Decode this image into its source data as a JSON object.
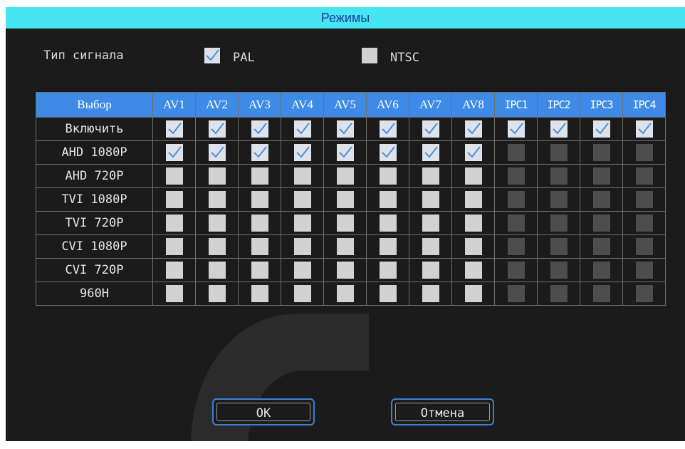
{
  "dialog": {
    "title": "Режимы",
    "signal_type": {
      "label": "Тип сигнала",
      "options": [
        {
          "label": "PAL",
          "checked": true
        },
        {
          "label": "NTSC",
          "checked": false
        }
      ]
    },
    "table": {
      "header_first": "Выбор",
      "columns": [
        "AV1",
        "AV2",
        "AV3",
        "AV4",
        "AV5",
        "AV6",
        "AV7",
        "AV8",
        "IPC1",
        "IPC2",
        "IPC3",
        "IPC4"
      ],
      "rows": [
        {
          "label": "Включить",
          "states": [
            "on",
            "on",
            "on",
            "on",
            "on",
            "on",
            "on",
            "on",
            "on",
            "on",
            "on",
            "on"
          ]
        },
        {
          "label": "AHD 1080P",
          "states": [
            "on",
            "on",
            "on",
            "on",
            "on",
            "on",
            "on",
            "on",
            "disabled",
            "disabled",
            "disabled",
            "disabled"
          ]
        },
        {
          "label": "AHD 720P",
          "states": [
            "off",
            "off",
            "off",
            "off",
            "off",
            "off",
            "off",
            "off",
            "disabled",
            "disabled",
            "disabled",
            "disabled"
          ]
        },
        {
          "label": "TVI 1080P",
          "states": [
            "off",
            "off",
            "off",
            "off",
            "off",
            "off",
            "off",
            "off",
            "disabled",
            "disabled",
            "disabled",
            "disabled"
          ]
        },
        {
          "label": "TVI 720P",
          "states": [
            "off",
            "off",
            "off",
            "off",
            "off",
            "off",
            "off",
            "off",
            "disabled",
            "disabled",
            "disabled",
            "disabled"
          ]
        },
        {
          "label": "CVI 1080P",
          "states": [
            "off",
            "off",
            "off",
            "off",
            "off",
            "off",
            "off",
            "off",
            "disabled",
            "disabled",
            "disabled",
            "disabled"
          ]
        },
        {
          "label": "CVI 720P",
          "states": [
            "off",
            "off",
            "off",
            "off",
            "off",
            "off",
            "off",
            "off",
            "disabled",
            "disabled",
            "disabled",
            "disabled"
          ]
        },
        {
          "label": "960H",
          "states": [
            "off",
            "off",
            "off",
            "off",
            "off",
            "off",
            "off",
            "off",
            "disabled",
            "disabled",
            "disabled",
            "disabled"
          ]
        }
      ]
    },
    "buttons": {
      "ok": "OK",
      "cancel": "Отмена"
    }
  },
  "colors": {
    "title_bar": "#45e5f2",
    "title_text": "#1c3c9c",
    "header_bg": "#3d8be6",
    "background": "#1b1b1b",
    "check_mark": "#4f8fe0",
    "button_border": "#3d7fd6"
  },
  "icons": {
    "checked": "checkmark-icon",
    "watermark": "logo-watermark"
  }
}
